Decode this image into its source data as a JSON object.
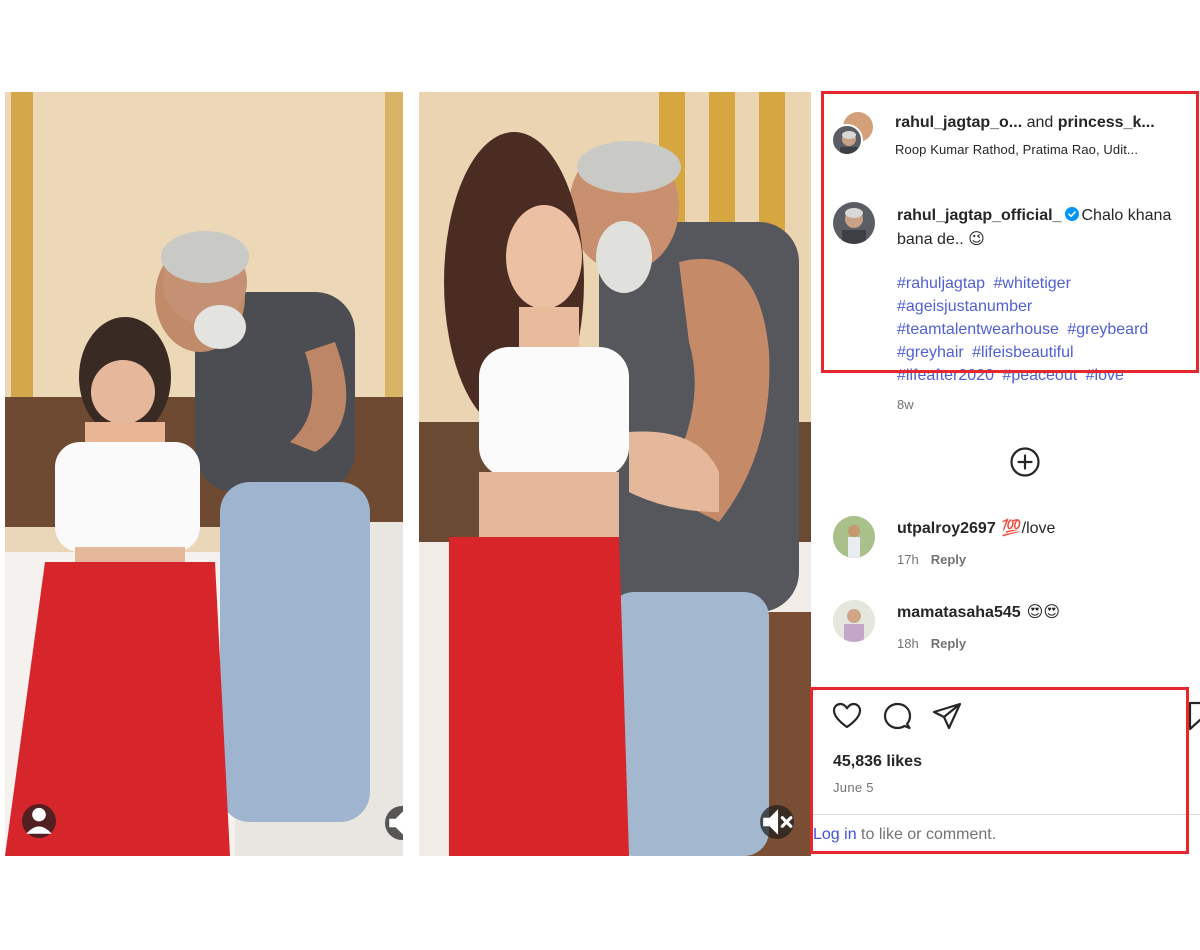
{
  "post": {
    "header": {
      "author": "rahul_jagtap_o...",
      "and_label": "and",
      "collaborator": "princess_k...",
      "audio": "Roop Kumar Rathod, Pratima Rao, Udit..."
    },
    "caption": {
      "username": "rahul_jagtap_official_",
      "text": "Chalo khana bana de.. 😉",
      "hashtags": [
        "#rahuljagtap",
        "#whitetiger",
        "#ageisjustanumber",
        "#teamtalentwearhouse",
        "#greybeard",
        "#greyhair",
        "#lifeisbeautiful",
        "#lifeafter2020",
        "#peaceout",
        "#love"
      ],
      "age": "8w"
    },
    "comments": [
      {
        "username": "utpalroy2697",
        "text": "💯/love",
        "age": "17h",
        "reply_label": "Reply"
      },
      {
        "username": "mamatasaha545",
        "text": "😍😍",
        "age": "18h",
        "reply_label": "Reply"
      }
    ],
    "likes": "45,836 likes",
    "date": "June 5",
    "login": {
      "link": "Log in",
      "rest": " to like or comment."
    }
  },
  "icons": {
    "like": "heart-icon",
    "comment": "comment-icon",
    "share": "share-icon",
    "more": "plus-circle-icon",
    "verified": "verified-badge-icon",
    "user_tag": "user-icon",
    "mute": "muted-speaker-icon"
  },
  "colors": {
    "highlight_box": "#e8262e",
    "hashtag": "#4f5fd6",
    "link": "#3f51d9",
    "verified": "#0095f6"
  }
}
